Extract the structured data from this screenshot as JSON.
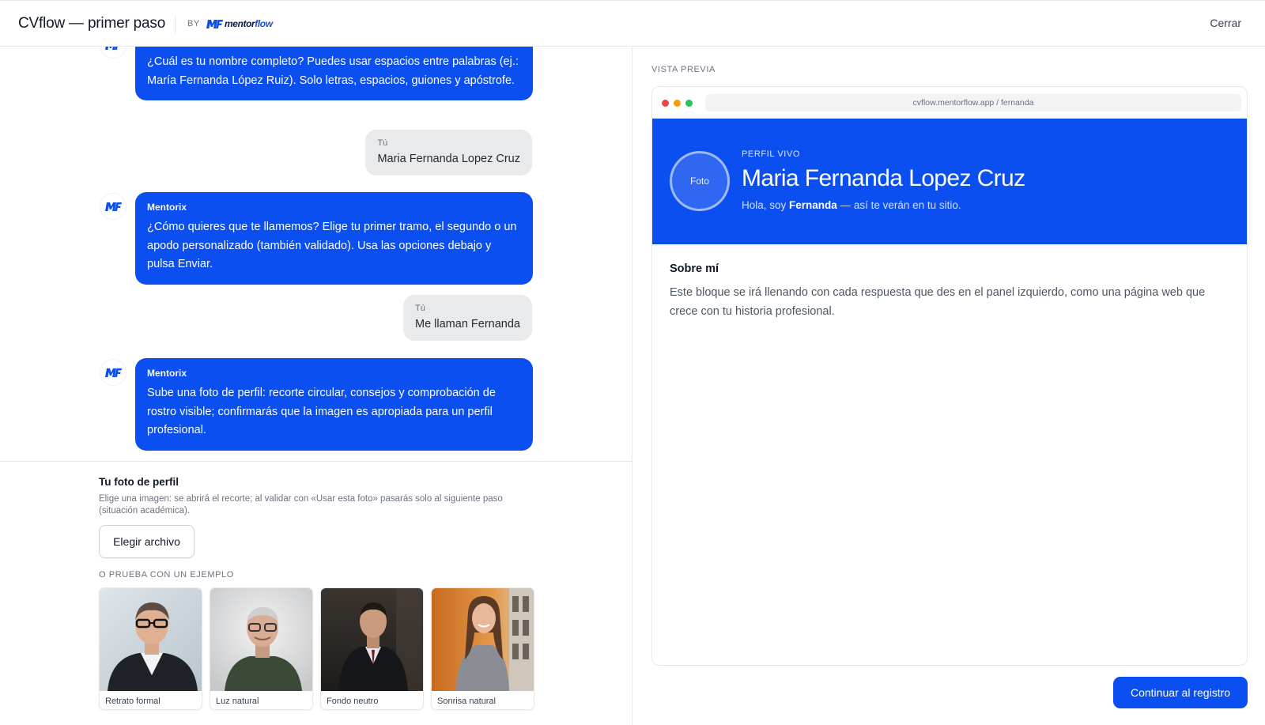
{
  "header": {
    "title": "CVflow — primer paso",
    "by_label": "BY",
    "brand": {
      "mark": "mf",
      "word_a": "mentor",
      "word_b": "flow"
    },
    "close_label": "Cerrar"
  },
  "chat": {
    "messages": [
      {
        "role": "bot",
        "author": "",
        "text": "¿Cuál es tu nombre completo? Puedes usar espacios entre palabras (ej.: María Fernanda López Ruiz). Solo letras, espacios, guiones y apóstrofe."
      },
      {
        "role": "user",
        "author": "Tú",
        "text": "Maria Fernanda Lopez Cruz"
      },
      {
        "role": "bot",
        "author": "Mentorix",
        "text": "¿Cómo quieres que te llamemos? Elige tu primer tramo, el segundo o un apodo personalizado (también validado). Usa las opciones debajo y pulsa Enviar."
      },
      {
        "role": "user",
        "author": "Tú",
        "text": "Me llaman Fernanda"
      },
      {
        "role": "bot",
        "author": "Mentorix",
        "text": "Sube una foto de perfil: recorte circular, consejos y comprobación de rostro visible; confirmarás que la imagen es apropiada para un perfil profesional."
      }
    ]
  },
  "photo_section": {
    "title": "Tu foto de perfil",
    "help": "Elige una imagen: se abrirá el recorte; al validar con «Usar esta foto» pasarás solo al siguiente paso (situación académica).",
    "file_button": "Elegir archivo",
    "examples_label": "O PRUEBA CON UN EJEMPLO",
    "examples": [
      {
        "caption": "Retrato formal"
      },
      {
        "caption": "Luz natural"
      },
      {
        "caption": "Fondo neutro"
      },
      {
        "caption": "Sonrisa natural"
      }
    ]
  },
  "preview": {
    "label": "VISTA PREVIA",
    "url": "cvflow.mentorflow.app / fernanda",
    "photo_placeholder": "Foto",
    "kicker": "PERFIL VIVO",
    "name": "Maria Fernanda Lopez Cruz",
    "greeting_prefix": "Hola, soy",
    "greeting_name": "Fernanda",
    "greeting_suffix": "— así te verán en tu sitio.",
    "about_title": "Sobre mí",
    "about_text": "Este bloque se irá llenando con cada respuesta que des en el panel izquierdo, como una página web que crece con tu historia profesional."
  },
  "actions": {
    "continue_label": "Continuar al registro"
  },
  "colors": {
    "accent": "#0b4ff0",
    "bubble_user": "#e9eaec",
    "window_dots": [
      "#ef4444",
      "#f59e0b",
      "#22c55e"
    ]
  }
}
